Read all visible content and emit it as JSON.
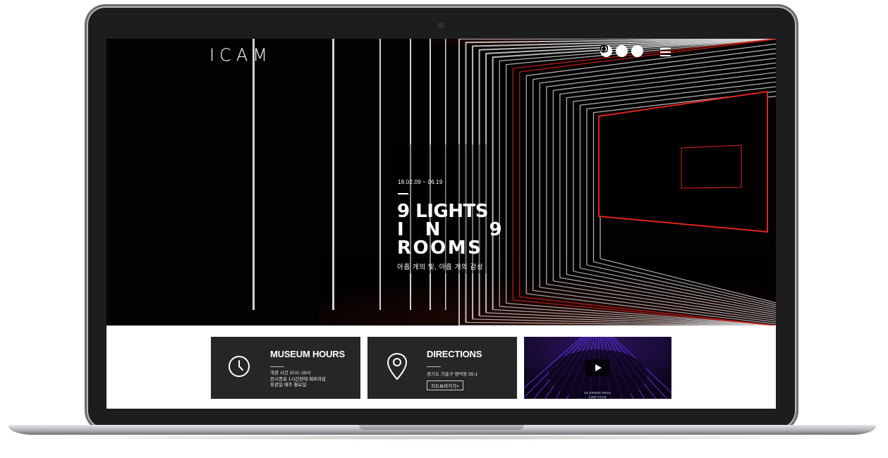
{
  "header": {
    "logo_text": "ICAM",
    "social": [
      "youtube-icon",
      "instagram-icon",
      "facebook-icon"
    ],
    "menu_icon": "hamburger-menu-icon"
  },
  "hero": {
    "date": "18.02.09 ~ 06.19",
    "title_line1": "9 LIGHTS",
    "title_line2": "IN 9",
    "title_line3": "ROOMS",
    "subtitle": "아홉 개의 빛, 아홉 개의 감성"
  },
  "cards": {
    "hours": {
      "title": "MUSEUM HOURS",
      "lines": [
        "개관 시간 10시~18시",
        "전시종료 1시간전에 매표마감",
        "휴관일 매주 월요일"
      ]
    },
    "directions": {
      "title": "DIRECTIONS",
      "address": "경기도 기흥구 영덕동 55-1",
      "map_button": "지도보러가기>"
    },
    "video": {
      "caption_line1": "03 ERWIN REDL",
      "caption_line2": "LINE FACE"
    }
  },
  "colors": {
    "accent_red": "#e0241b",
    "card_bg": "#262626",
    "video_violet": "#6a3cff"
  }
}
